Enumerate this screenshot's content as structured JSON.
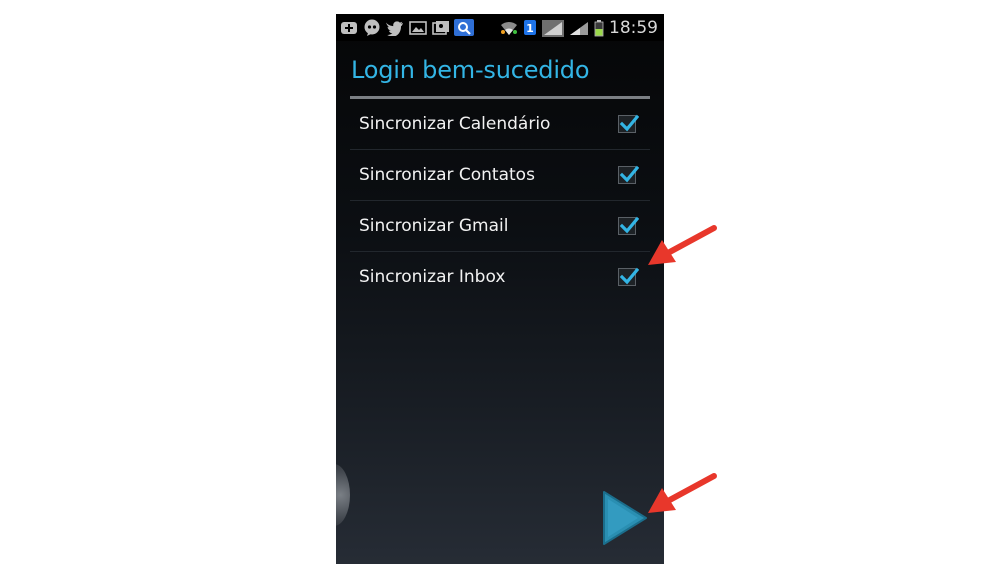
{
  "status_bar": {
    "icons": [
      "add-icon",
      "chat-bubble-icon",
      "twitter-icon",
      "image-icon",
      "gallery-icon",
      "search-icon",
      "wifi-icon",
      "one-badge-icon",
      "signal-icon",
      "signal-icon",
      "battery-icon"
    ],
    "time": "18:59"
  },
  "dialog": {
    "title": "Login bem-sucedido",
    "items": [
      {
        "label": "Sincronizar Calendário",
        "checked": true
      },
      {
        "label": "Sincronizar Contatos",
        "checked": true
      },
      {
        "label": "Sincronizar Gmail",
        "checked": true
      },
      {
        "label": "Sincronizar Inbox",
        "checked": true
      }
    ]
  },
  "colors": {
    "accent": "#33b5e5",
    "annotation_arrow": "#e8372b",
    "next_button": "#2a8fb2"
  },
  "annotations": [
    "red-arrow-icon",
    "red-arrow-icon"
  ]
}
